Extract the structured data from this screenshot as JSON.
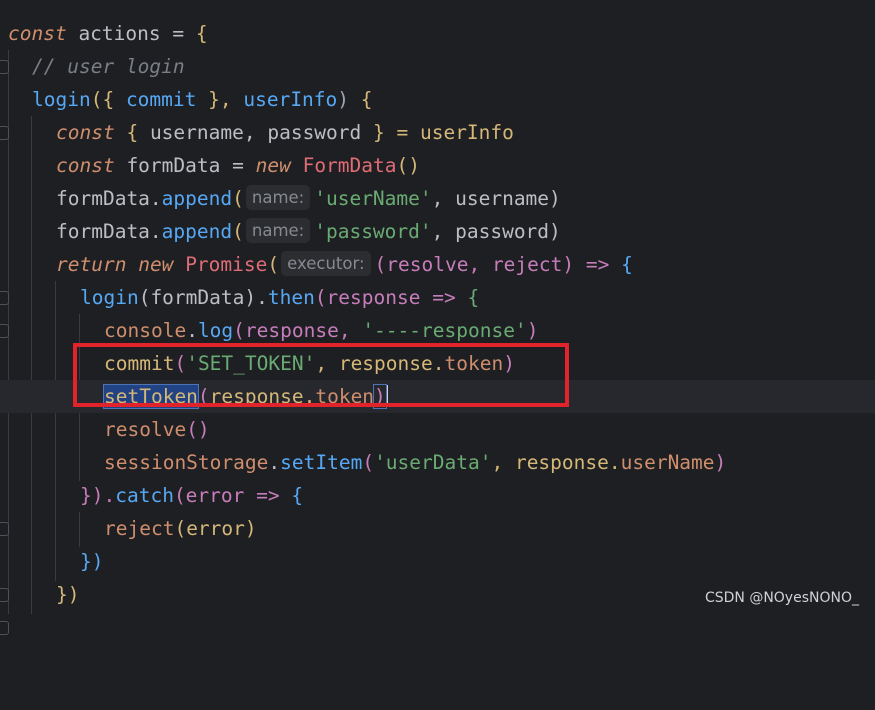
{
  "lines": [
    {
      "p1": "const",
      "p2": " actions = ",
      "p3": "{"
    },
    {
      "p1": "// user login"
    },
    {
      "p1": "login",
      "p2": "({ ",
      "p3": "commit",
      "p4": " }, ",
      "p5": "userInfo",
      "p6": ") ",
      "p7": "{"
    },
    {
      "p1": "const",
      "p2": " { ",
      "p3": "username",
      "p4": ", ",
      "p5": "password",
      "p6": " } = ",
      "p7": "userInfo"
    },
    {
      "p1": "const",
      "p2": " formData = ",
      "p3": "new",
      "p4": " ",
      "p5": "FormData",
      "p6": "()"
    },
    {
      "p1": "formData.",
      "p2": "append",
      "p3": "(",
      "hint": "name:",
      "p4": "'userName'",
      "p5": ", username)"
    },
    {
      "p1": "formData.",
      "p2": "append",
      "p3": "(",
      "hint": "name:",
      "p4": "'password'",
      "p5": ", password)"
    },
    {
      "p1": "return",
      "p2": " ",
      "p3": "new",
      "p4": " ",
      "p5": "Promise",
      "p6": "(",
      "hint": "executor:",
      "p7": "(resolve, reject) => ",
      "p8": "{"
    },
    {
      "p1": "login",
      "p2": "(formData).",
      "p3": "then",
      "p4": "(response => ",
      "p5": "{"
    },
    {
      "p1": "console",
      "p2": ".",
      "p3": "log",
      "p4": "(response, ",
      "p5": "'----response'",
      "p6": ")"
    },
    {
      "p1": "commit",
      "p2": "(",
      "p3": "'SET_TOKEN'",
      "p4": ", response.",
      "p5": "token",
      "p6": ")"
    },
    {
      "p1": "setToken",
      "p2": "(",
      "p3": "response.",
      "p4": "token",
      ",p5": ")",
      "p5": ")"
    },
    {
      "p1": "resolve",
      "p2": "()"
    },
    {
      "p1": "sessionStorage",
      "p2": ".",
      "p3": "setItem",
      "p4": "(",
      "p5": "'userData'",
      "p6": ", response.",
      "p7": "userName",
      "p8": ")"
    },
    {
      "p1": "}).",
      "p2": "catch",
      "p3": "(error => ",
      "p4": "{"
    },
    {
      "p1": "reject",
      "p2": "(error)"
    },
    {
      "p1": "})"
    },
    {
      "p1": "})"
    }
  ],
  "watermark": "CSDN @NOyesNONO_",
  "colors": {
    "background": "#1e1f22",
    "keyword": "#cf8e6d",
    "function": "#56a8f5",
    "string": "#6aab73",
    "highlight_box": "#e1242b"
  }
}
